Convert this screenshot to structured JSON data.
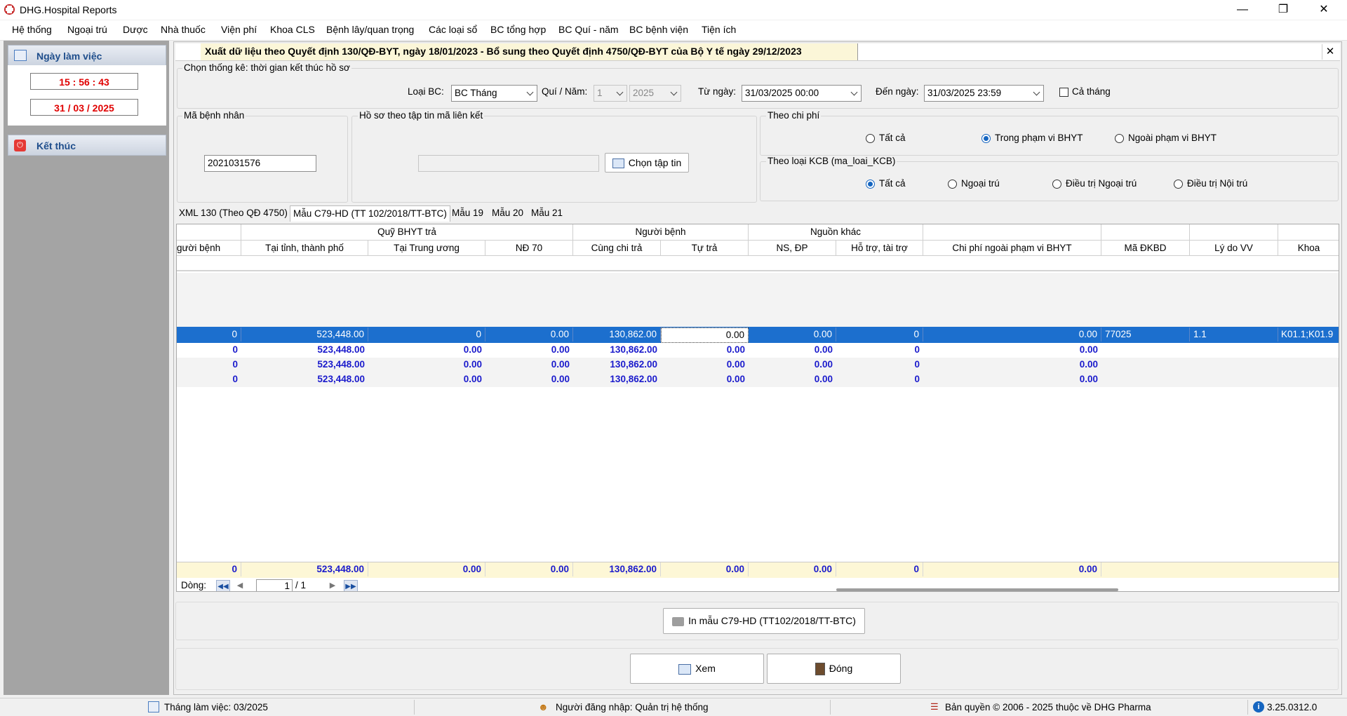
{
  "window": {
    "title": "DHG.Hospital Reports"
  },
  "menu": [
    "Hệ thống",
    "Ngoại trú",
    "Dược",
    "Nhà thuốc",
    "Viện phí",
    "Khoa CLS",
    "Bệnh lây/quan trọng",
    "Các loại sổ",
    "BC tổng hợp",
    "BC Quí - năm",
    "BC bệnh viện",
    "Tiện ích"
  ],
  "sidebar": {
    "workday_label": "Ngày làm việc",
    "time": "15 : 56 : 43",
    "date": "31 / 03 / 2025",
    "exit_label": "Kết thúc"
  },
  "header": {
    "title": "Xuất dữ liệu theo Quyết định 130/QĐ-BYT, ngày 18/01/2023 - Bổ sung theo Quyết định 4750/QĐ-BYT của Bộ Y tế ngày 29/12/2023"
  },
  "filter": {
    "group_label": "Chọn thống kê: thời gian kết thúc hồ sơ",
    "report_type_label": "Loại BC:",
    "report_type_value": "BC Tháng",
    "quarter_year_label": "Quí / Năm:",
    "quarter_value": "1",
    "year_value": "2025",
    "from_label": "Từ ngày:",
    "from_value": "31/03/2025 00:00",
    "to_label": "Đến ngày:",
    "to_value": "31/03/2025 23:59",
    "full_month_label": "Cả tháng"
  },
  "patient": {
    "group_label": "Mã bệnh nhân",
    "value": "2021031576"
  },
  "file_group": {
    "label": "Hồ sơ theo tập tin mã liên kết",
    "choose_button": "Chọn tập tin"
  },
  "cost_group": {
    "label": "Theo chi phí",
    "options": [
      "Tất cả",
      "Trong phạm vi BHYT",
      "Ngoài phạm vi BHYT"
    ],
    "selected": 1
  },
  "kcb_group": {
    "label": "Theo loại KCB (ma_loai_KCB)",
    "options": [
      "Tất cả",
      "Ngoại trú",
      "Điều trị Ngoại trú",
      "Điều trị Nội trú"
    ],
    "selected": 0
  },
  "tabs": [
    "XML 130 (Theo QĐ 4750)",
    "Mẫu C79-HD (TT 102/2018/TT-BTC)",
    "Mẫu 19",
    "Mẫu 20",
    "Mẫu 21"
  ],
  "active_tab": 1,
  "grid": {
    "group_headers": [
      "Quỹ BHYT trả",
      "Người bệnh",
      "Nguồn khác"
    ],
    "columns": [
      "gười bệnh",
      "Tại tỉnh, thành phố",
      "Tại Trung ương",
      "NĐ 70",
      "Cùng chi trả",
      "Tự trả",
      "NS, ĐP",
      "Hỗ trợ, tài trợ",
      "Chi phí ngoài phạm vi BHYT",
      "Mã ĐKBD",
      "Lý do VV",
      "Khoa"
    ],
    "selected_row": [
      "0",
      "523,448.00",
      "0",
      "0.00",
      "130,862.00",
      "0.00",
      "0.00",
      "0",
      "0.00",
      "77025",
      "1.1",
      "K01.1;K01.9"
    ],
    "summary_rows": [
      [
        "0",
        "523,448.00",
        "0.00",
        "0.00",
        "130,862.00",
        "0.00",
        "0.00",
        "0",
        "0.00"
      ],
      [
        "0",
        "523,448.00",
        "0.00",
        "0.00",
        "130,862.00",
        "0.00",
        "0.00",
        "0",
        "0.00"
      ],
      [
        "0",
        "523,448.00",
        "0.00",
        "0.00",
        "130,862.00",
        "0.00",
        "0.00",
        "0",
        "0.00"
      ]
    ],
    "footer_row": [
      "0",
      "523,448.00",
      "0.00",
      "0.00",
      "130,862.00",
      "0.00",
      "0.00",
      "0",
      "0.00"
    ]
  },
  "pager": {
    "label": "Dòng:",
    "current": "1",
    "total": "/ 1"
  },
  "buttons": {
    "print": "In mẫu C79-HD (TT102/2018/TT-BTC)",
    "view": "Xem",
    "close": "Đóng"
  },
  "status": {
    "month": "Tháng làm việc: 03/2025",
    "user": "Người đăng nhập: Quản trị hệ thống",
    "copyright": "Bản quyền © 2006 - 2025 thuộc về DHG Pharma",
    "version": "3.25.0312.0"
  },
  "colors": {
    "accent": "#1565c0",
    "selected_row": "#1c6fce",
    "time_red": "#e00000",
    "footer_bg": "#fdf7d6"
  }
}
